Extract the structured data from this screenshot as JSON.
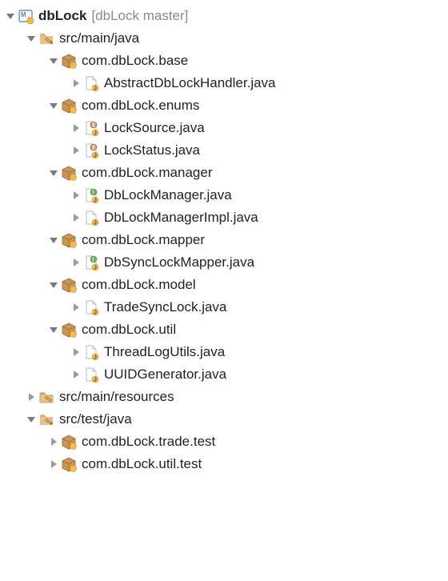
{
  "root": {
    "name": "dbLock",
    "vcs": "[dbLock master]"
  },
  "src_main_java": "src/main/java",
  "packages": {
    "base": {
      "name": "com.dbLock.base",
      "files": [
        "AbstractDbLockHandler.java"
      ]
    },
    "enums": {
      "name": "com.dbLock.enums",
      "files": [
        "LockSource.java",
        "LockStatus.java"
      ]
    },
    "manager": {
      "name": "com.dbLock.manager",
      "files": [
        "DbLockManager.java",
        "DbLockManagerImpl.java"
      ]
    },
    "mapper": {
      "name": "com.dbLock.mapper",
      "files": [
        "DbSyncLockMapper.java"
      ]
    },
    "model": {
      "name": "com.dbLock.model",
      "files": [
        "TradeSyncLock.java"
      ]
    },
    "util": {
      "name": "com.dbLock.util",
      "files": [
        "ThreadLogUtils.java",
        "UUIDGenerator.java"
      ]
    }
  },
  "src_main_resources": "src/main/resources",
  "src_test_java": "src/test/java",
  "test_packages": {
    "trade": "com.dbLock.trade.test",
    "util": "com.dbLock.util.test"
  }
}
